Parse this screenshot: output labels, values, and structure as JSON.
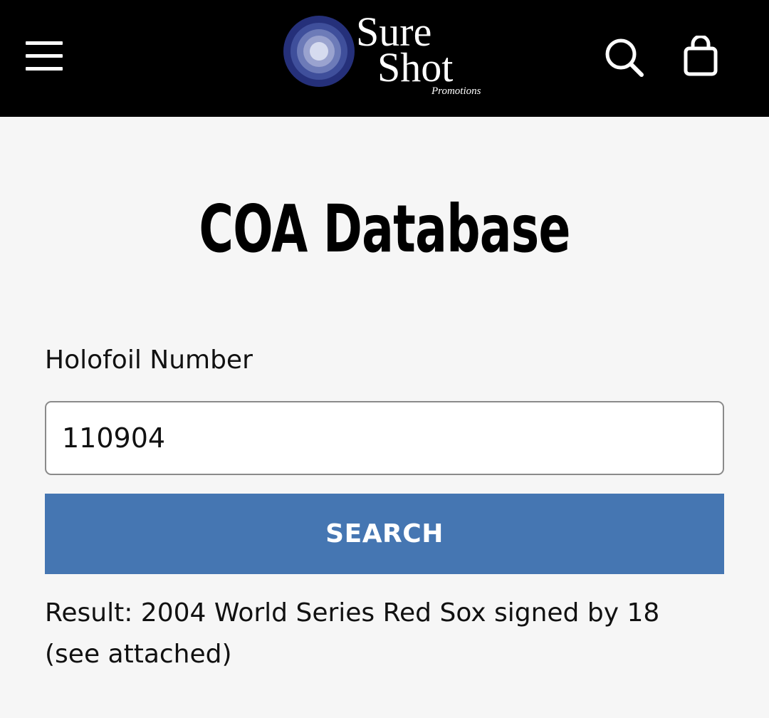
{
  "header": {
    "logo": {
      "line1": "Sure",
      "line2": "Shot",
      "tagline": "Promotions"
    },
    "icons": [
      "menu-icon",
      "search-icon",
      "shopping-bag-icon"
    ],
    "background_color": "#000000"
  },
  "main": {
    "title": "COA Database",
    "field_label": "Holofoil Number",
    "input_value": "110904",
    "search_button_label": "SEARCH",
    "result_text": "Result: 2004 World Series Red Sox signed by 18 (see attached)"
  },
  "colors": {
    "accent": "#4576b2",
    "page_background": "#f6f6f6"
  }
}
